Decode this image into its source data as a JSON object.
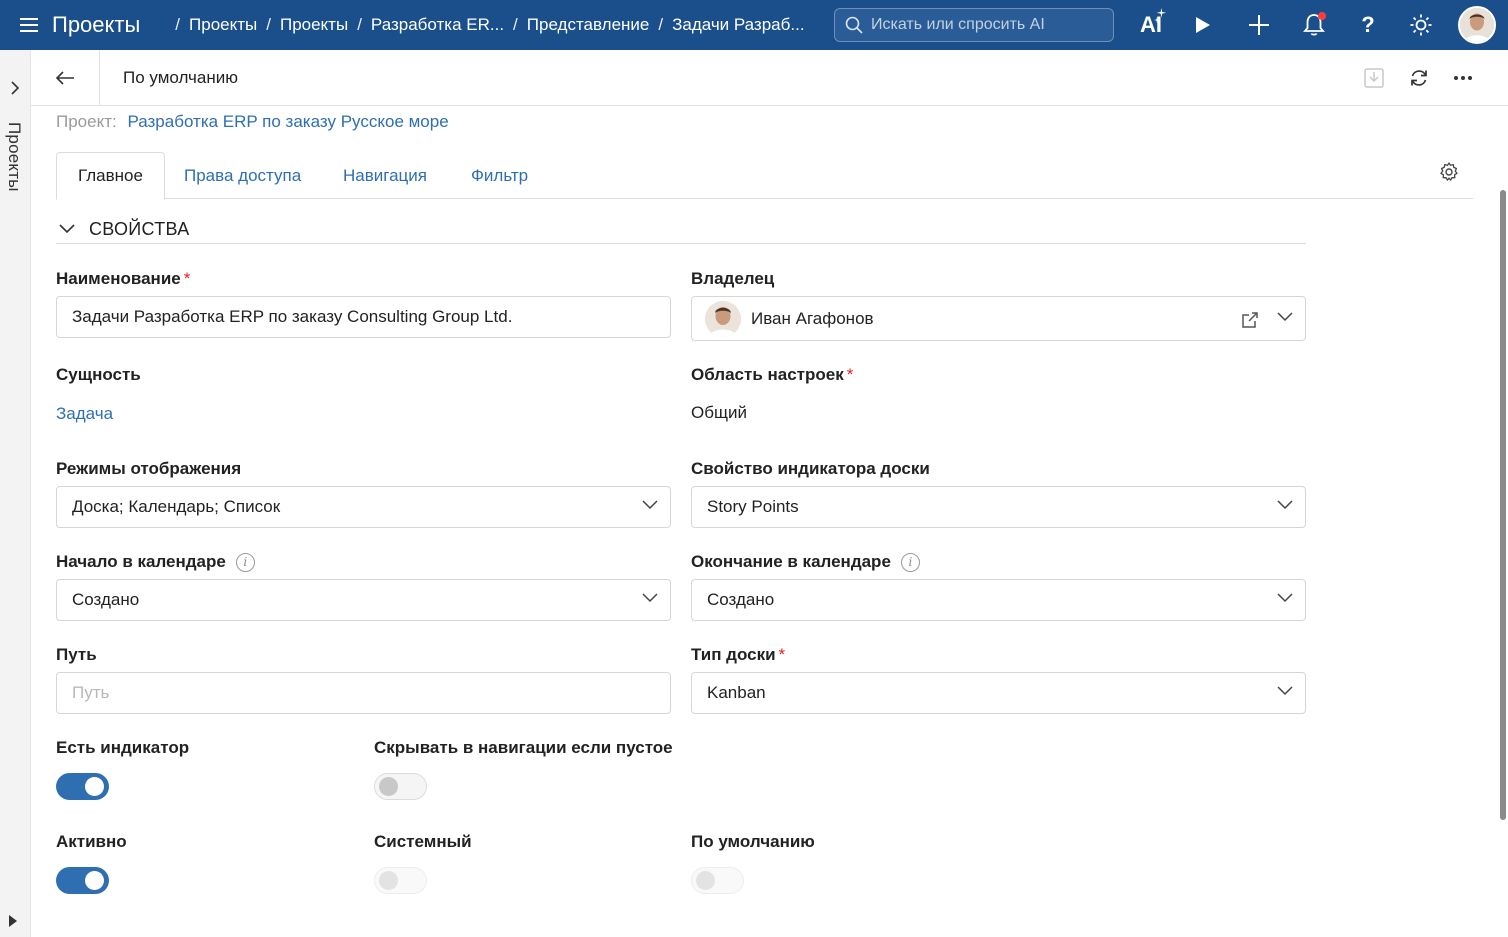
{
  "topbar": {
    "app_title": "Проекты",
    "breadcrumbs": [
      "Проекты",
      "Проекты",
      "Разработка ER...",
      "Представление",
      "Задачи Разраб..."
    ],
    "search_placeholder": "Искать или спросить AI",
    "ai_label": "AI"
  },
  "leftrail": {
    "label": "Проекты"
  },
  "header": {
    "title": "По умолчанию"
  },
  "project": {
    "label": "Проект:",
    "name": "Разработка ERP по заказу Русское море"
  },
  "tabs": [
    "Главное",
    "Права доступа",
    "Навигация",
    "Фильтр"
  ],
  "section": {
    "title": "СВОЙСТВА"
  },
  "fields": {
    "name": {
      "label": "Наименование",
      "value": "Задачи Разработка ERP по заказу Consulting Group Ltd."
    },
    "owner": {
      "label": "Владелец",
      "value": "Иван Агафонов"
    },
    "entity": {
      "label": "Сущность",
      "value": "Задача"
    },
    "scope": {
      "label": "Область настроек",
      "value": "Общий"
    },
    "modes": {
      "label": "Режимы отображения",
      "value": "Доска; Календарь; Список"
    },
    "board_indicator": {
      "label": "Свойство индикатора доски",
      "value": "Story Points"
    },
    "cal_start": {
      "label": "Начало в календаре",
      "value": "Создано"
    },
    "cal_end": {
      "label": "Окончание в календаре",
      "value": "Создано"
    },
    "path": {
      "label": "Путь",
      "placeholder": "Путь"
    },
    "board_type": {
      "label": "Тип доски",
      "value": "Kanban"
    }
  },
  "toggles": {
    "has_indicator": {
      "label": "Есть индикатор",
      "on": true
    },
    "hide_if_empty": {
      "label": "Скрывать в навигации если пустое",
      "on": false
    },
    "active": {
      "label": "Активно",
      "on": true
    },
    "system": {
      "label": "Системный",
      "on": false
    },
    "default": {
      "label": "По умолчанию",
      "on": false
    }
  },
  "colors": {
    "topbar": "#1a4f8b",
    "accent": "#2f6fb1",
    "required": "#dd2222",
    "notification": "#ff3b3b"
  }
}
